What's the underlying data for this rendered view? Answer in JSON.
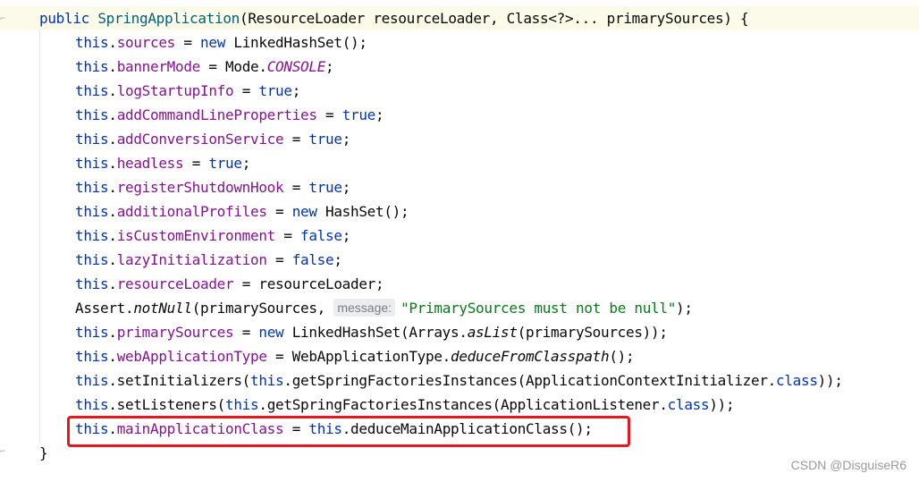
{
  "editor": {
    "line_highlight_color": "#fcfbe9",
    "constructor_line": {
      "public": "public",
      "name": "SpringApplication",
      "param_open": "(ResourceLoader resourceLoader, Class<?>... primarySources) {"
    },
    "this_kw": "this",
    "new_kw": "new",
    "true_kw": "true",
    "false_kw": "false",
    "class_kw": "class",
    "line_sources": {
      "field": "sources",
      "eq": " = ",
      "rest": " LinkedHashSet();"
    },
    "line_bannerMode": {
      "field": "bannerMode",
      "eq": " = Mode.",
      "const": "CONSOLE",
      "end": ";"
    },
    "line_logStartupInfo": {
      "field": "logStartupInfo",
      "eq": " = ",
      "end": ";"
    },
    "line_addCommandLineProperties": {
      "field": "addCommandLineProperties",
      "eq": " = ",
      "end": ";"
    },
    "line_addConversionService": {
      "field": "addConversionService",
      "eq": " = ",
      "end": ";"
    },
    "line_headless": {
      "field": "headless",
      "eq": " = ",
      "end": ";"
    },
    "line_registerShutdownHook": {
      "field": "registerShutdownHook",
      "eq": " = ",
      "end": ";"
    },
    "line_additionalProfiles": {
      "field": "additionalProfiles",
      "eq": " = ",
      "rest": " HashSet();"
    },
    "line_isCustomEnvironment": {
      "field": "isCustomEnvironment",
      "eq": " = ",
      "end": ";"
    },
    "line_lazyInitialization": {
      "field": "lazyInitialization",
      "eq": " = ",
      "end": ";"
    },
    "line_resourceLoader": {
      "field": "resourceLoader",
      "rest": " = resourceLoader;"
    },
    "line_assert": {
      "prefix": "Assert.",
      "method": "notNull",
      "args": "(primarySources, ",
      "hint": "message:",
      "string": "\"PrimarySources must not be null\"",
      "end": ");"
    },
    "line_primarySources": {
      "field": "primarySources",
      "eq": " = ",
      "mid": " LinkedHashSet(Arrays.",
      "method": "asList",
      "end": "(primarySources));"
    },
    "line_webApplicationType": {
      "field": "webApplicationType",
      "eq": " = WebApplicationType.",
      "method": "deduceFromClasspath",
      "end": "();"
    },
    "line_setInitializers": {
      "mid1": ".setInitializers(",
      "mid2": ".getSpringFactoriesInstances(ApplicationContextInitializer.",
      "end": "));"
    },
    "line_setListeners": {
      "mid1": ".setListeners(",
      "mid2": ".getSpringFactoriesInstances(ApplicationListener.",
      "end": "));"
    },
    "line_mainApplicationClass": {
      "field": "mainApplicationClass",
      "eq": " = ",
      "rest": ".deduceMainApplicationClass();"
    },
    "closing_brace": "}"
  },
  "annotation": {
    "color": "#e8161d"
  },
  "watermark": "CSDN @DisguiseR6"
}
